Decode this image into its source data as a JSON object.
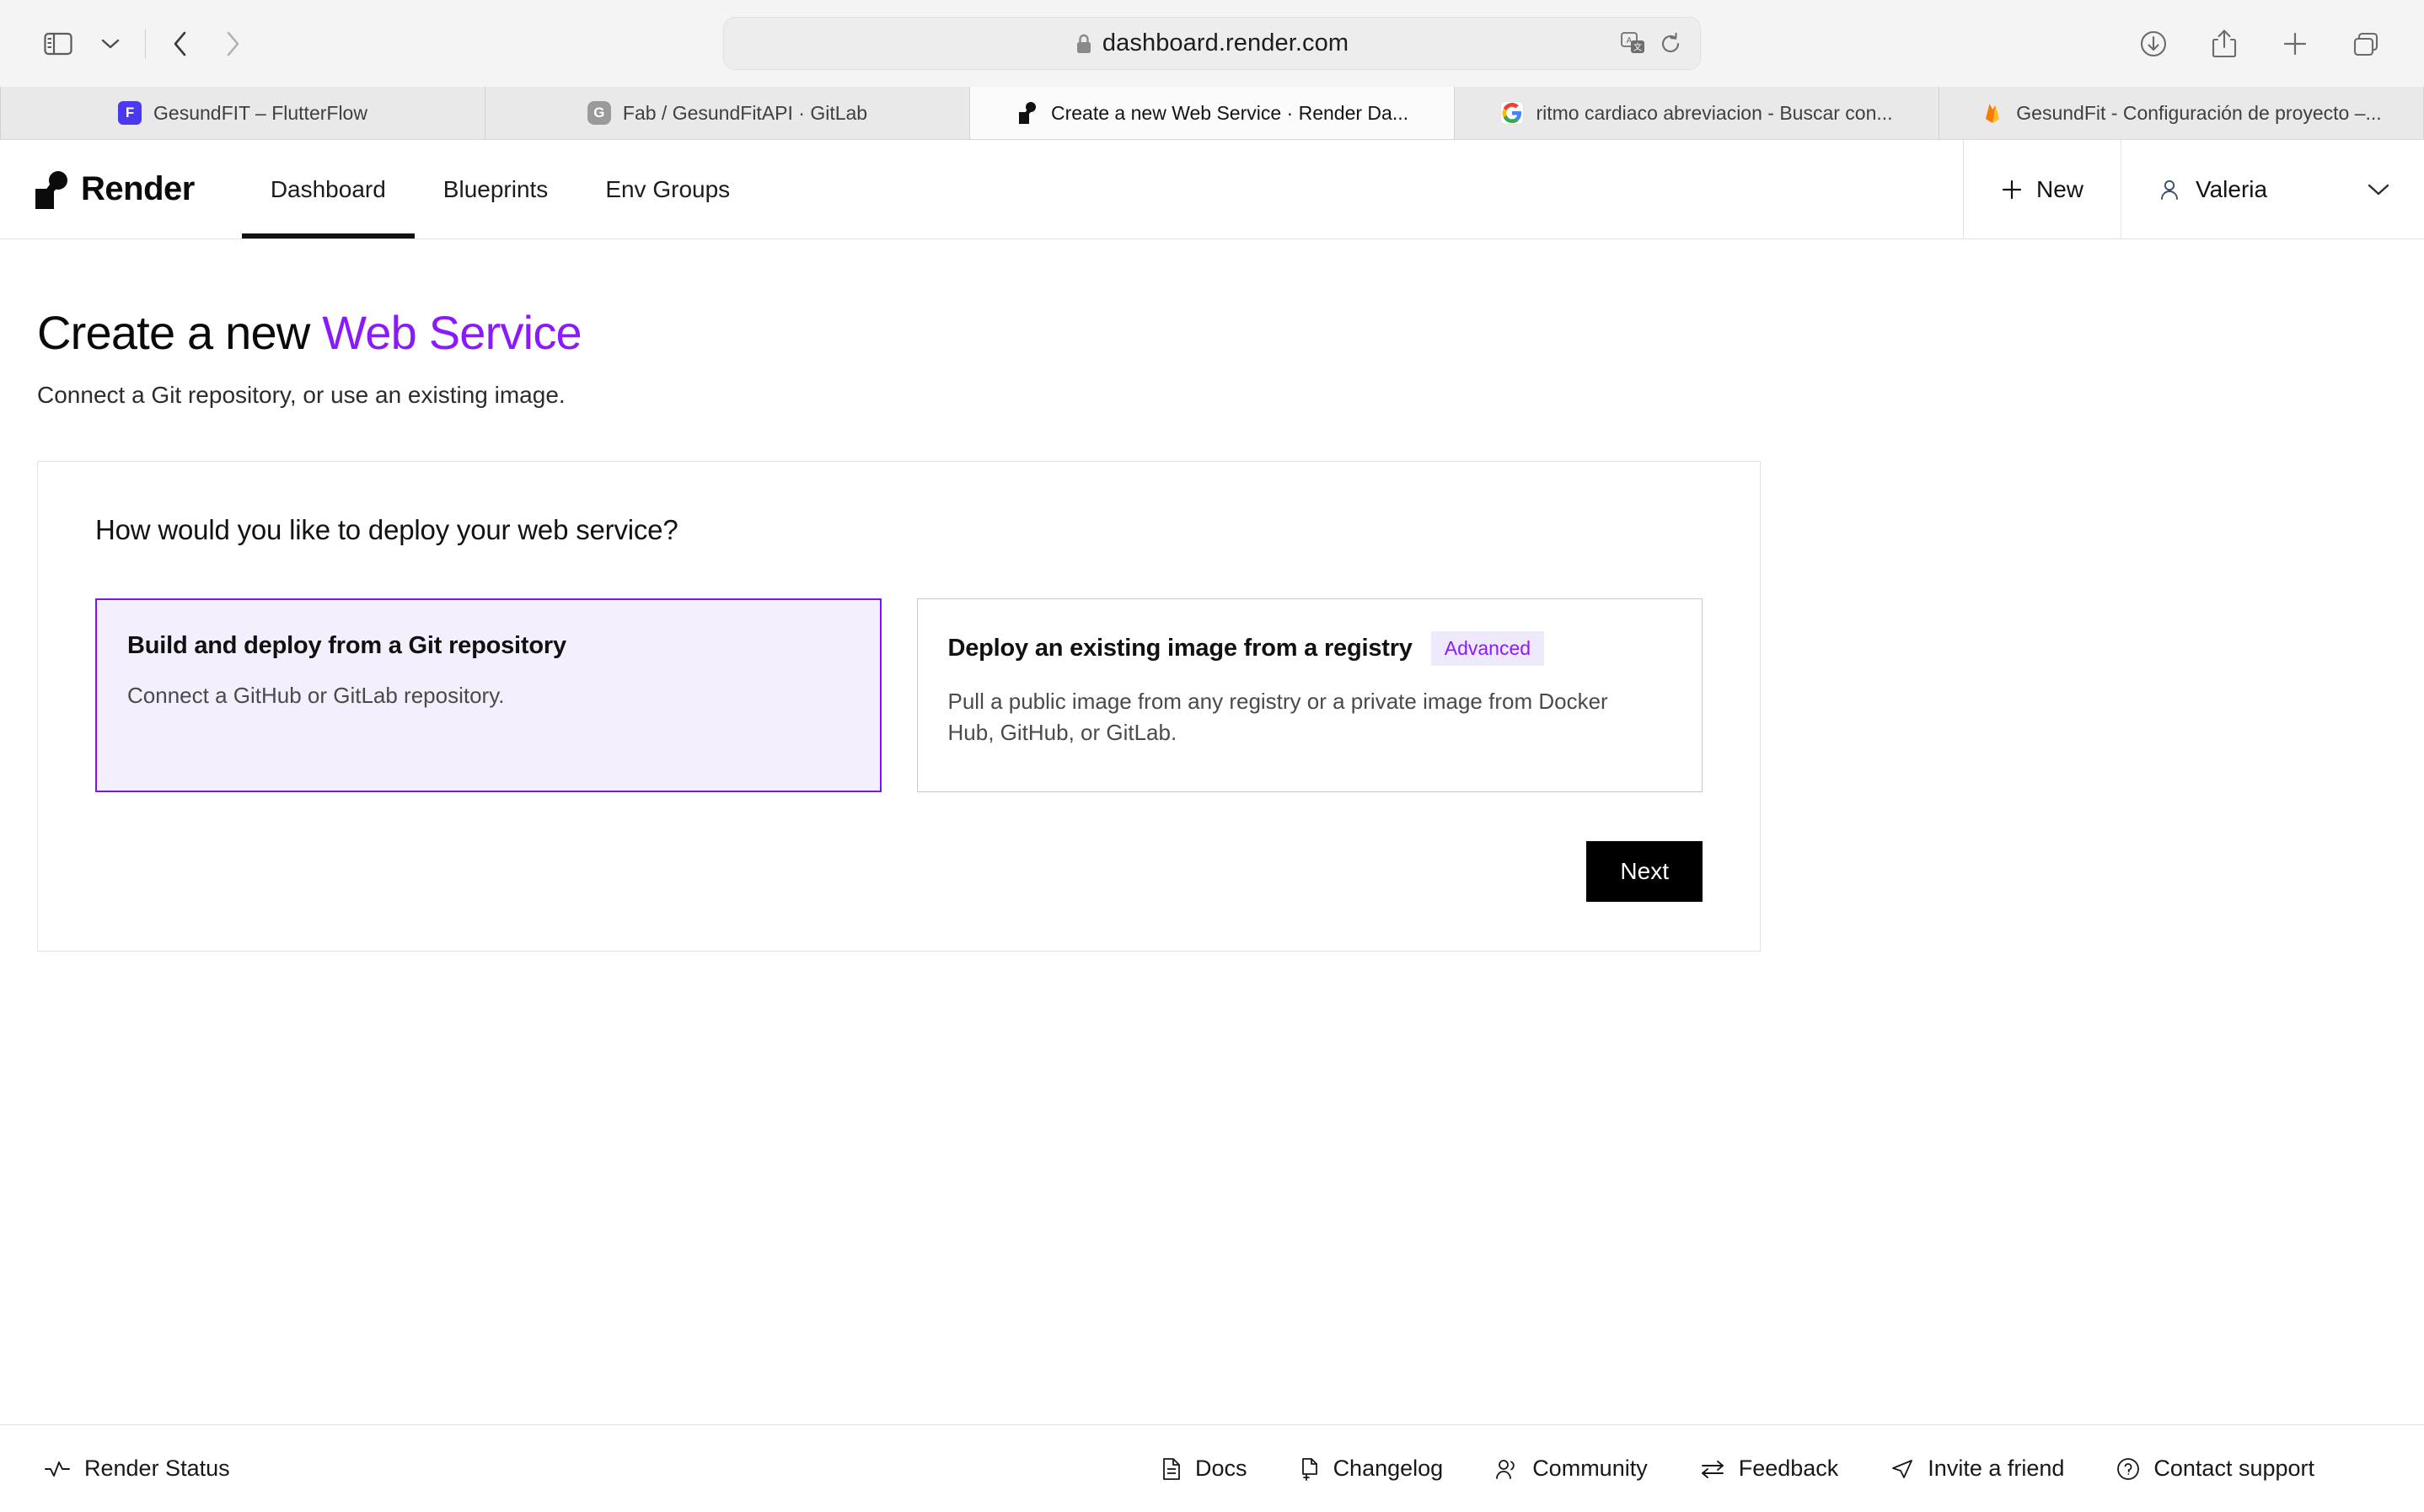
{
  "browser": {
    "url": "dashboard.render.com",
    "lock_icon": "lock-icon",
    "sidebar_icon": "sidebar-toggle-icon",
    "tab_overview_icon": "chevron-down-icon",
    "back_icon": "chevron-left-icon",
    "forward_icon": "chevron-right-icon",
    "translate_icon": "translate-icon",
    "reload_icon": "reload-icon",
    "downloads_icon": "downloads-icon",
    "share_icon": "share-icon",
    "new_tab_icon": "plus-icon",
    "tabs_overview_icon": "tab-group-icon",
    "tabs": [
      {
        "title": "GesundFIT – FlutterFlow",
        "favicon": "flutterflow-icon",
        "active": false
      },
      {
        "title": "Fab / GesundFitAPI · GitLab",
        "favicon": "gitlab-icon",
        "active": false
      },
      {
        "title": "Create a new Web Service  ·  Render Da...",
        "favicon": "render-icon",
        "active": true
      },
      {
        "title": "ritmo cardiaco  abreviacion  - Buscar con...",
        "favicon": "google-icon",
        "active": false
      },
      {
        "title": "GesundFit - Configuración de proyecto –...",
        "favicon": "firebase-icon",
        "active": false
      }
    ]
  },
  "app_header": {
    "brand": "Render",
    "brand_logo_icon": "render-logo-icon",
    "nav": [
      {
        "label": "Dashboard",
        "active": true
      },
      {
        "label": "Blueprints",
        "active": false
      },
      {
        "label": "Env Groups",
        "active": false
      }
    ],
    "new_button": {
      "label": "New",
      "icon": "plus-icon"
    },
    "account": {
      "name": "Valeria",
      "icon": "user-icon",
      "chevron": "chevron-down-icon"
    }
  },
  "page": {
    "title_lead": "Create a new",
    "title_accent": "Web Service",
    "subtitle": "Connect a Git repository, or use an existing image.",
    "accent_color": "#8a19ff"
  },
  "panel": {
    "question": "How would you like to deploy your web service?",
    "options": [
      {
        "title": "Build and deploy from a Git repository",
        "description": "Connect a GitHub or GitLab repository.",
        "badge": null,
        "selected": true
      },
      {
        "title": "Deploy an existing image from a registry",
        "description": "Pull a public image from any registry or a private image from Docker Hub, GitHub, or GitLab.",
        "badge": "Advanced",
        "selected": false
      }
    ],
    "next_label": "Next"
  },
  "footer": {
    "status": {
      "label": "Render Status",
      "icon": "activity-icon"
    },
    "links": [
      {
        "label": "Docs",
        "icon": "document-icon"
      },
      {
        "label": "Changelog",
        "icon": "document-plus-icon"
      },
      {
        "label": "Community",
        "icon": "users-icon"
      },
      {
        "label": "Feedback",
        "icon": "exchange-arrows-icon"
      },
      {
        "label": "Invite a friend",
        "icon": "send-icon"
      },
      {
        "label": "Contact support",
        "icon": "question-circle-icon"
      }
    ]
  }
}
